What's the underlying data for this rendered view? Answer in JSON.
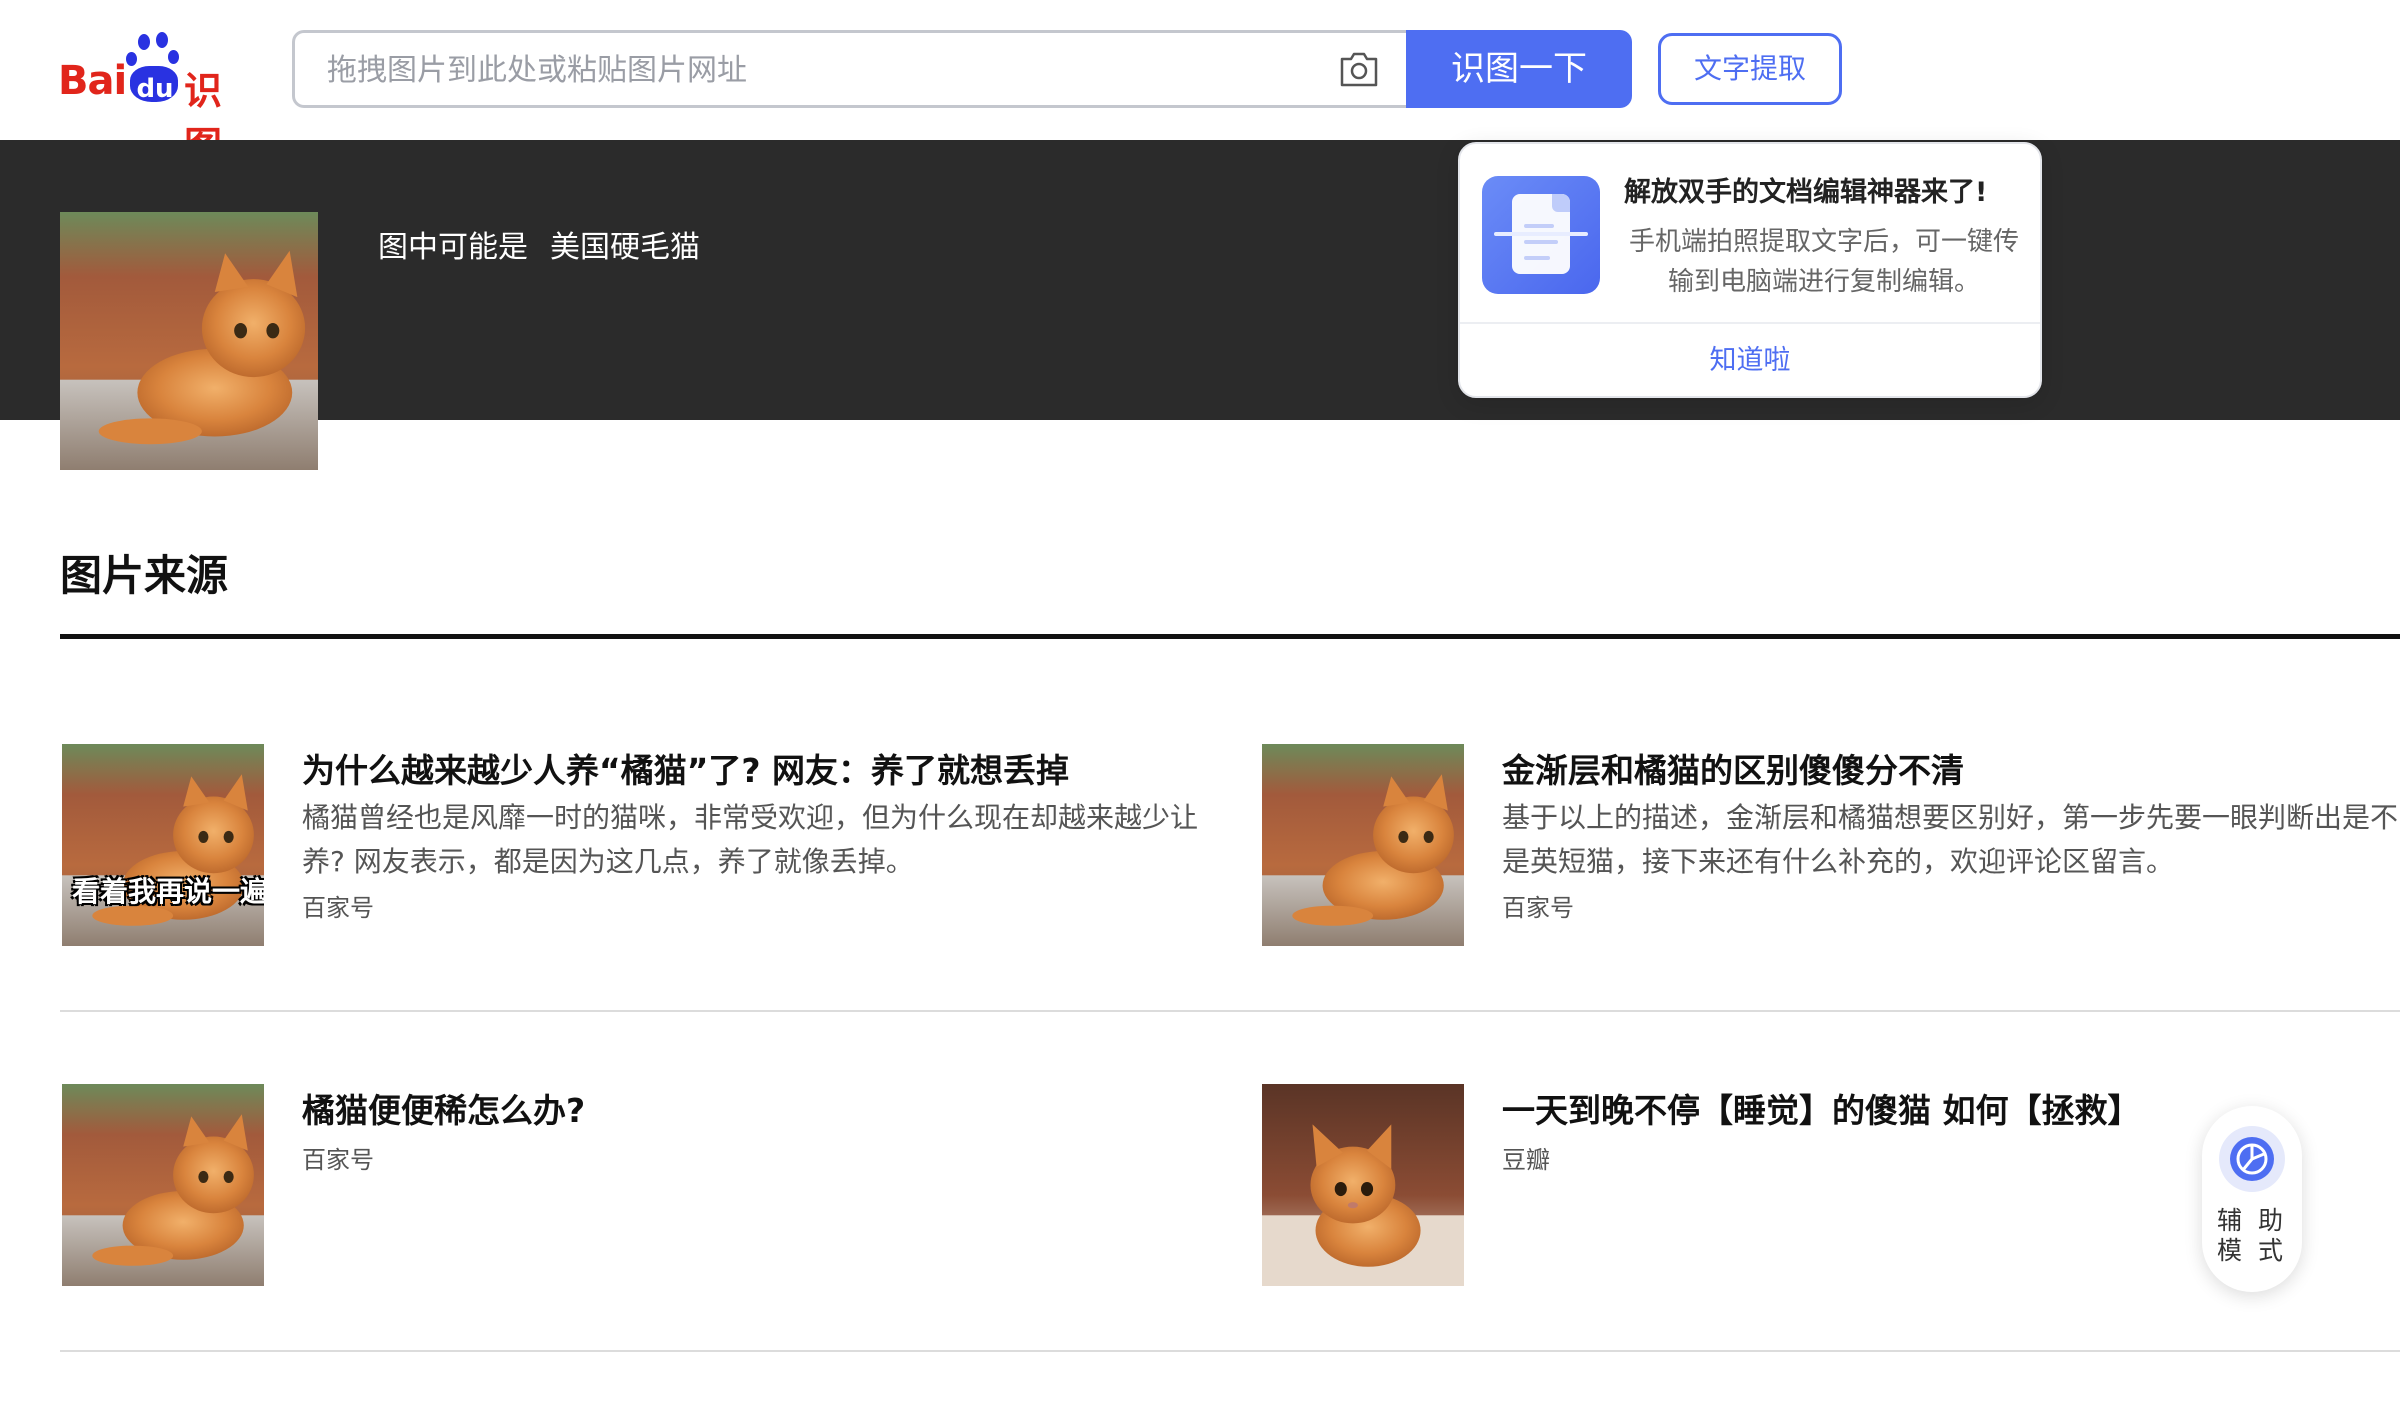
{
  "header": {
    "logo_text_bai": "Bai",
    "logo_text_du": "du",
    "logo_text_product": "识图",
    "search_placeholder": "拖拽图片到此处或粘贴图片网址",
    "search_button": "识图一下",
    "ocr_button": "文字提取",
    "camera_icon": "camera-icon"
  },
  "result": {
    "prefix": "图中可能是",
    "name": "美国硬毛猫"
  },
  "popup": {
    "title": "解放双手的文档编辑神器来了!",
    "body": "手机端拍照提取文字后，可一键传输到电脑端进行复制编辑。",
    "ok_button": "知道啦"
  },
  "sources": {
    "section_title": "图片来源",
    "items": [
      {
        "title": "为什么越来越少人养“橘猫”了? 网友：养了就想丢掉",
        "desc": "橘猫曾经也是风靡一时的猫咪，非常受欢迎，但为什么现在却越来越少让养? 网友表示，都是因为这几点，养了就像丢掉。",
        "source": "百家号",
        "overlay_caption": "看着我再说一遍"
      },
      {
        "title": "金渐层和橘猫的区别傻傻分不清",
        "desc": "基于以上的描述，金渐层和橘猫想要区别好，第一步先要一眼判断出是不是英短猫，接下来还有什么补充的，欢迎评论区留言。",
        "source": "百家号"
      },
      {
        "title": "橘猫便便稀怎么办?",
        "source": "百家号"
      },
      {
        "title": "一天到晚不停【睡觉】的傻猫 如何【拯救】",
        "source": "豆瓣"
      }
    ]
  },
  "assist": {
    "label": "辅 助 模 式",
    "icon": "accessibility-icon"
  },
  "colors": {
    "accent": "#4e6ef2",
    "band": "#2b2b2b",
    "brand_red": "#e1251b",
    "brand_blue": "#2932e1"
  }
}
